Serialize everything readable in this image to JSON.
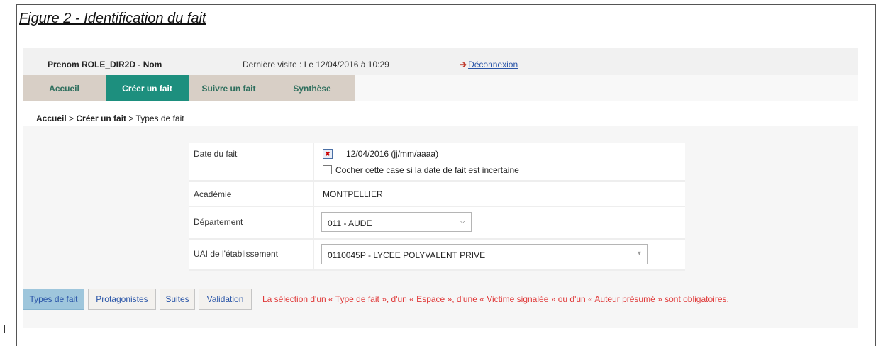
{
  "figure": {
    "caption": "Figure 2 - Identification du fait"
  },
  "header": {
    "user": "Prenom ROLE_DIR2D - Nom",
    "last_visit": "Dernière visite : Le 12/04/2016 à 10:29",
    "logout_label": "Déconnexion"
  },
  "nav": {
    "tabs": [
      {
        "label": "Accueil"
      },
      {
        "label": "Créer un fait",
        "active": true
      },
      {
        "label": "Suivre un fait"
      },
      {
        "label": "Synthèse"
      }
    ]
  },
  "breadcrumb": {
    "home": "Accueil",
    "sep1": " > ",
    "create": "Créer un fait",
    "sep2": " > ",
    "current": "Types de fait"
  },
  "form": {
    "date": {
      "label": "Date du fait",
      "value": "12/04/2016 (jj/mm/aaaa)",
      "uncertain_label": "Cocher cette case si la date de fait est incertaine",
      "uncertain_checked": false
    },
    "academie": {
      "label": "Académie",
      "value": "MONTPELLIER"
    },
    "departement": {
      "label": "Département",
      "value": "011 - AUDE"
    },
    "uai": {
      "label": "UAI de l'établissement",
      "value": "0110045P - LYCEE POLYVALENT PRIVE"
    }
  },
  "steps": {
    "tabs": [
      {
        "label": "Types de fait",
        "active": true
      },
      {
        "label": "Protagonistes"
      },
      {
        "label": "Suites"
      },
      {
        "label": "Validation"
      }
    ],
    "warning": "La sélection d'un « Type de fait », d'un « Espace », d'une « Victime signalée » ou d'un « Auteur présumé » sont obligatoires."
  },
  "colors": {
    "active_tab": "#1d8f7e",
    "tab_bg": "#d8cfc6",
    "warning": "#e03a3a",
    "link": "#2a55a8",
    "active_step": "#9ec6dc"
  },
  "icons": {
    "logout": "logout-icon",
    "calendar": "calendar-icon",
    "dropdown": "chevron-down-icon"
  }
}
